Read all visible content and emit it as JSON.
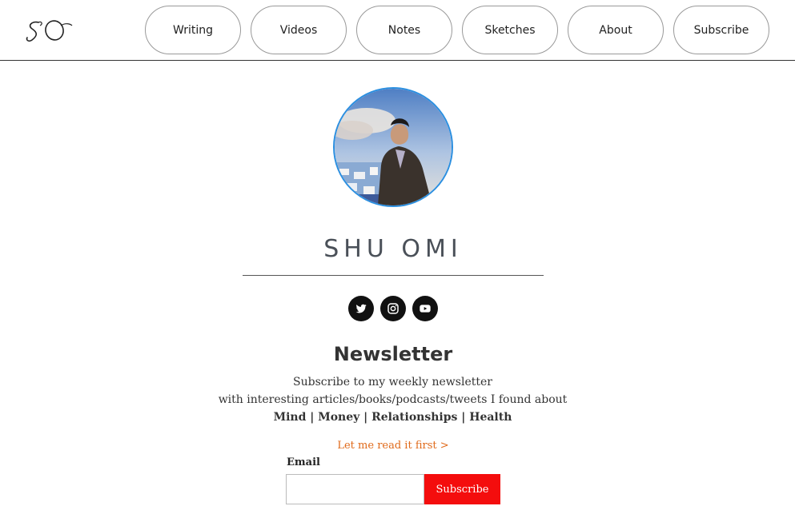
{
  "header": {
    "logo_text": "SO",
    "nav": [
      {
        "label": "Writing"
      },
      {
        "label": "Videos"
      },
      {
        "label": "Notes"
      },
      {
        "label": "Sketches"
      },
      {
        "label": "About"
      },
      {
        "label": "Subscribe"
      }
    ]
  },
  "profile": {
    "name": "SHU OMI",
    "avatar_border_color": "#2b8fe0"
  },
  "social": [
    {
      "icon": "twitter-icon"
    },
    {
      "icon": "instagram-icon"
    },
    {
      "icon": "youtube-icon"
    }
  ],
  "newsletter": {
    "title": "Newsletter",
    "line1": "Subscribe to my weekly newsletter",
    "line2": "with interesting articles/books/podcasts/tweets I found about",
    "topics": "Mind | Money | Relationships | Health",
    "read_first": "Let me read it first >",
    "email_label": "Email",
    "email_value": "",
    "subscribe_label": "Subscribe",
    "subscribe_color": "#f40d0d",
    "link_color": "#e06a1a"
  }
}
